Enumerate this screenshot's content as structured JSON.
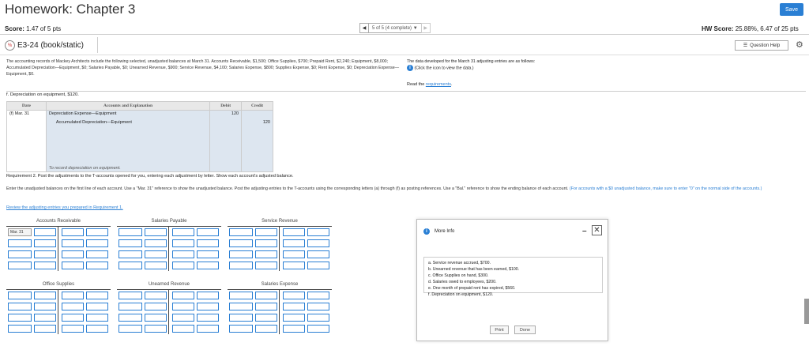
{
  "header": {
    "title": "Homework: Chapter 3",
    "save_label": "Save"
  },
  "scorebar": {
    "score_label": "Score:",
    "score_value": "1.47 of 5 pts",
    "pager_text": "5 of 5 (4 complete) ▼",
    "prev": "◀",
    "next": "▶",
    "hw_score_label": "HW Score:",
    "hw_score_value": "25.88%, 6.47 of 25 pts"
  },
  "question": {
    "id": "E3-24 (book/static)",
    "help_label": "Question Help",
    "intro": "The accounting records of Mackey Architects include the following selected, unadjusted balances at March 31. Accounts Receivable, $1,500; Office Supplies, $700; Prepaid Rent, $2,240; Equipment, $8,000; Accumulated Depreciation—Equipment, $0; Salaries Payable, $0; Unearned Revenue, $900; Service Revenue, $4,100; Salaries Expense, $800; Supplies Expense, $0; Rent Expense, $0; Depreciation Expense—Equipment, $0.",
    "data_line1": "The data developed for the March 31 adjusting entries are as follows:",
    "data_line2": "(Click the icon to view the data.)",
    "read_prefix": "Read the ",
    "read_link": "requirements",
    "read_suffix": "."
  },
  "journal": {
    "label": "f. Depreciation on equipment, $120.",
    "headers": [
      "Date",
      "Accounts and Explanation",
      "Debit",
      "Credit"
    ],
    "row1": {
      "date": "(f) Mar. 31",
      "account": "Depreciation Expense—Equipment",
      "debit": "120",
      "credit": ""
    },
    "row2": {
      "date": "",
      "account": "Accumulated Depreciation—Equipment",
      "debit": "",
      "credit": "120"
    },
    "note": "To record depreciation on equipment."
  },
  "requirement2": {
    "title": "Requirement 2. Post the adjustments to the T-accounts opened for you, entering each adjustment by letter. Show each account's adjusted balance.",
    "body": "Enter the unadjusted balances on the first line of each account. Use a \"Mar. 31\" reference to show the unadjusted balance. Post the adjusting entries to the T-accounts using the corresponding letters (a) through (f) as posting references. Use a \"Bal.\" reference to show the ending balance of each account.",
    "body_blue": "(For accounts with a $0 unadjusted balance, make sure to enter \"0\" on the normal side of the accounts.)",
    "review_link": "Review the adjusting entries you prepared in Requirement 1."
  },
  "taccounts": [
    {
      "name": "Accounts Receivable",
      "first_ref": "Mar. 31"
    },
    {
      "name": "Salaries Payable",
      "first_ref": ""
    },
    {
      "name": "Service Revenue",
      "first_ref": ""
    },
    {
      "name": "Office Supplies",
      "first_ref": ""
    },
    {
      "name": "Unearned Revenue",
      "first_ref": ""
    },
    {
      "name": "Salaries Expense",
      "first_ref": ""
    }
  ],
  "modal": {
    "title": "More Info",
    "items": [
      "a. Service revenue accrued, $700.",
      "b. Unearned revenue that has been earned, $100.",
      "c. Office Supplies on hand, $300.",
      "d. Salaries owed to employees, $200.",
      "e. One month of prepaid rent has expired, $560.",
      "f. Depreciation on equipment, $120."
    ],
    "print_label": "Print",
    "done_label": "Done",
    "minimize": "–",
    "close": "✕"
  },
  "colors": {
    "accent": "#2a7fd4"
  }
}
